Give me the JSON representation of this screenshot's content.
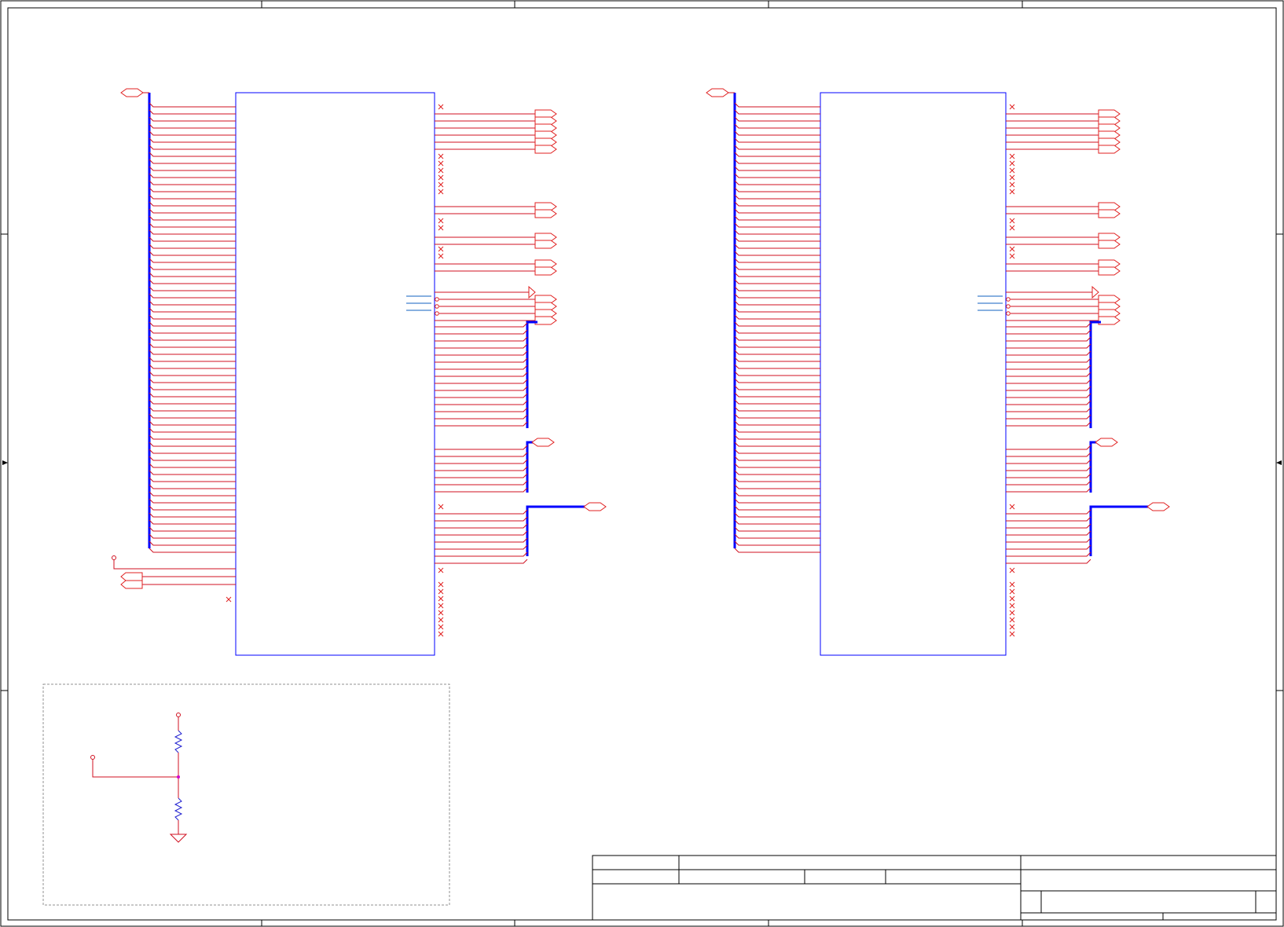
{
  "sheet": {
    "type": "schematic",
    "colors": {
      "frame": "#000000",
      "component_body": "#0000ff",
      "wire": "#d01020",
      "bus": "#0000ff",
      "net_port": "#e02020",
      "resistor": "#2020d0",
      "junction": "#d000d0",
      "annotation_box": "#909090",
      "no_connect_mark": "#e02020"
    },
    "icons": {
      "no_connect": "x-mark-icon",
      "net_port": "hexagon-port-icon",
      "ground": "ground-triangle-icon",
      "resistor": "zigzag-resistor-icon",
      "power_pin": "open-circle-icon",
      "buffer": "triangle-buffer-icon"
    },
    "parts": [
      {
        "role": "left-component",
        "left_pins": 70,
        "right_pins_connected": 46
      },
      {
        "role": "right-component",
        "left_pins": 70,
        "right_pins_connected": 46
      }
    ],
    "title_block": {
      "visible_text": []
    }
  }
}
